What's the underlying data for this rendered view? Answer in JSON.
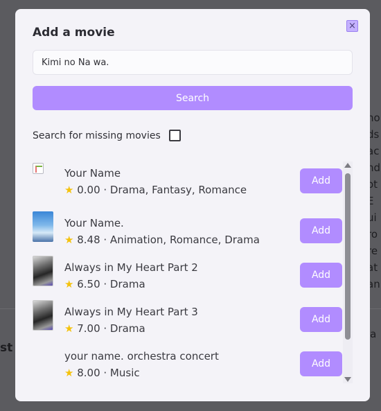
{
  "background": {
    "right_fragments": [
      "ho",
      "ds",
      "ac",
      "nd",
      "ot",
      " E",
      "ui",
      "ro",
      "re",
      "at",
      "an",
      "",
      "",
      "ia"
    ],
    "left_fragment": "st"
  },
  "modal": {
    "title": "Add a movie",
    "close_icon": "×",
    "search": {
      "value": "Kimi no Na wa.",
      "button_label": "Search"
    },
    "missing": {
      "label": "Search for missing movies",
      "checked": false
    }
  },
  "results": [
    {
      "title": "Your Name",
      "star": "★",
      "meta": "0.00 · Drama, Fantasy, Romance",
      "add_label": "Add",
      "poster": "broken-image"
    },
    {
      "title": "Your Name.",
      "star": "★",
      "meta": "8.48 · Animation, Romance, Drama",
      "add_label": "Add",
      "poster": "sky-poster"
    },
    {
      "title": "Always in My Heart Part 2",
      "star": "★",
      "meta": "6.50 · Drama",
      "add_label": "Add",
      "poster": "gray-poster"
    },
    {
      "title": "Always in My Heart Part 3",
      "star": "★",
      "meta": "7.00 · Drama",
      "add_label": "Add",
      "poster": "gray-poster"
    },
    {
      "title": "your name. orchestra concert",
      "star": "★",
      "meta": "8.00 · Music",
      "add_label": "Add",
      "poster": ""
    }
  ],
  "colors": {
    "accent": "#b18cff",
    "star": "#f4c20d"
  }
}
